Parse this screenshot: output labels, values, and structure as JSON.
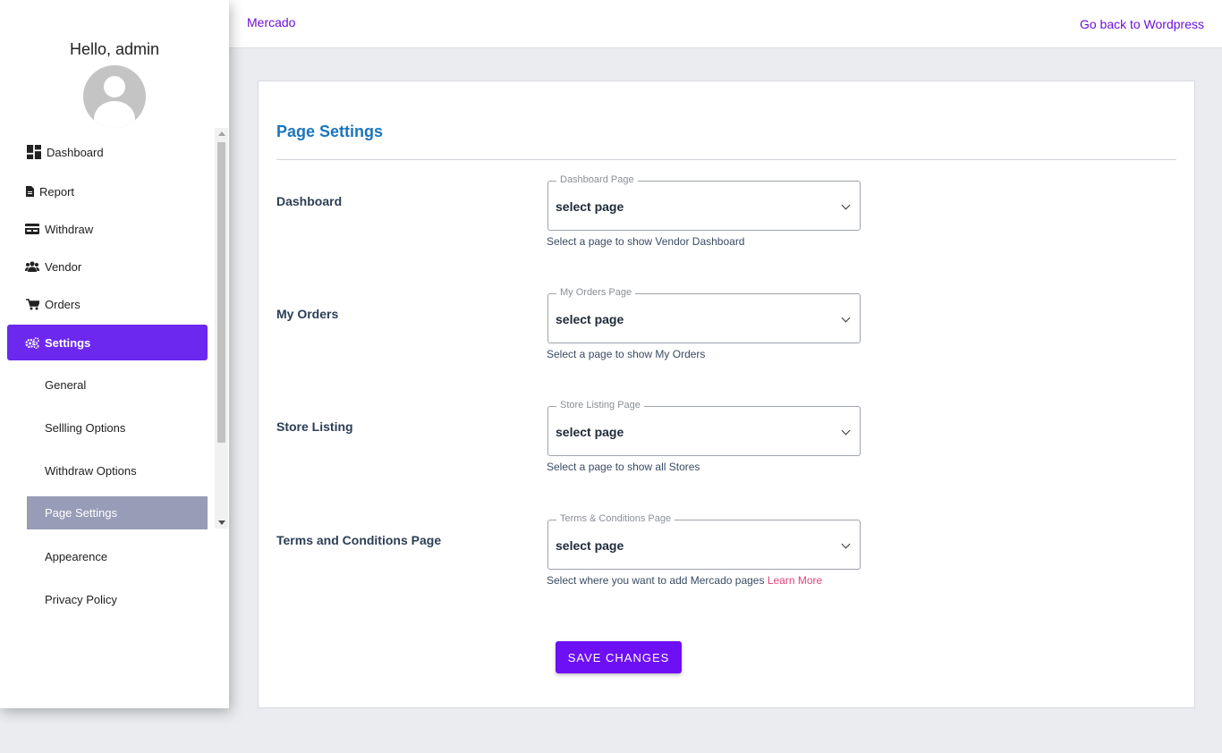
{
  "topbar": {
    "brand": "Mercado",
    "back_link": "Go back to Wordpress"
  },
  "sidebar": {
    "greeting": "Hello, admin",
    "items": [
      {
        "label": "Dashboard",
        "icon": "dashboard-icon"
      },
      {
        "label": "Report",
        "icon": "file-icon"
      },
      {
        "label": "Withdraw",
        "icon": "card-icon"
      },
      {
        "label": "Vendor",
        "icon": "users-icon"
      },
      {
        "label": "Orders",
        "icon": "cart-icon"
      },
      {
        "label": "Settings",
        "icon": "gears-icon",
        "active": true
      }
    ],
    "sub_items": [
      {
        "label": "General"
      },
      {
        "label": "Sellling Options"
      },
      {
        "label": "Withdraw Options"
      },
      {
        "label": "Page Settings",
        "active": true
      },
      {
        "label": "Appearence"
      },
      {
        "label": "Privacy Policy"
      }
    ]
  },
  "main": {
    "title": "Page Settings",
    "rows": [
      {
        "label": "Dashboard",
        "legend": "Dashboard Page",
        "value": "select page",
        "help": "Select a page to show Vendor Dashboard"
      },
      {
        "label": "My Orders",
        "legend": "My Orders Page",
        "value": "select page",
        "help": "Select a page to show My Orders"
      },
      {
        "label": "Store Listing",
        "legend": "Store Listing Page",
        "value": "select page",
        "help": "Select a page to show all Stores"
      },
      {
        "label": "Terms and Conditions Page",
        "legend": "Terms & Conditions Page",
        "value": "select page",
        "help": "Select where you want to add Mercado pages",
        "help_link": "Learn More"
      }
    ],
    "save_label": "SAVE CHANGES"
  },
  "colors": {
    "accent": "#6d10f5",
    "title_blue": "#1c75bc",
    "active_sub": "#979cb7",
    "link_pink": "#e2447a"
  }
}
